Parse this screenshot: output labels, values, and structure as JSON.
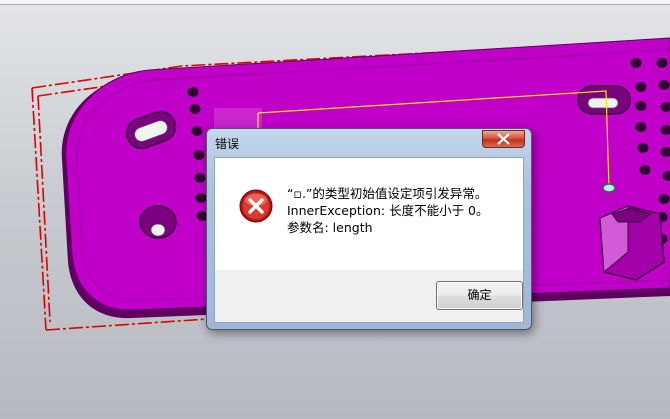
{
  "dialog": {
    "title": "错误",
    "message_lines": [
      "“▫.”的类型初始值设定项引发异常。",
      "InnerException: 长度不能小于 0。",
      "参数名: length"
    ],
    "ok_label": "确定",
    "close_icon": "close-icon",
    "error_icon": "error-icon"
  },
  "colors": {
    "part": "#c000c8",
    "part_edge": "#5a005e",
    "bounding_box": "#e00000",
    "guide_line": "#f3e600",
    "background_top": "#e3e5e8",
    "background_bottom": "#b6b9bf",
    "close_button": "#c2321d"
  }
}
